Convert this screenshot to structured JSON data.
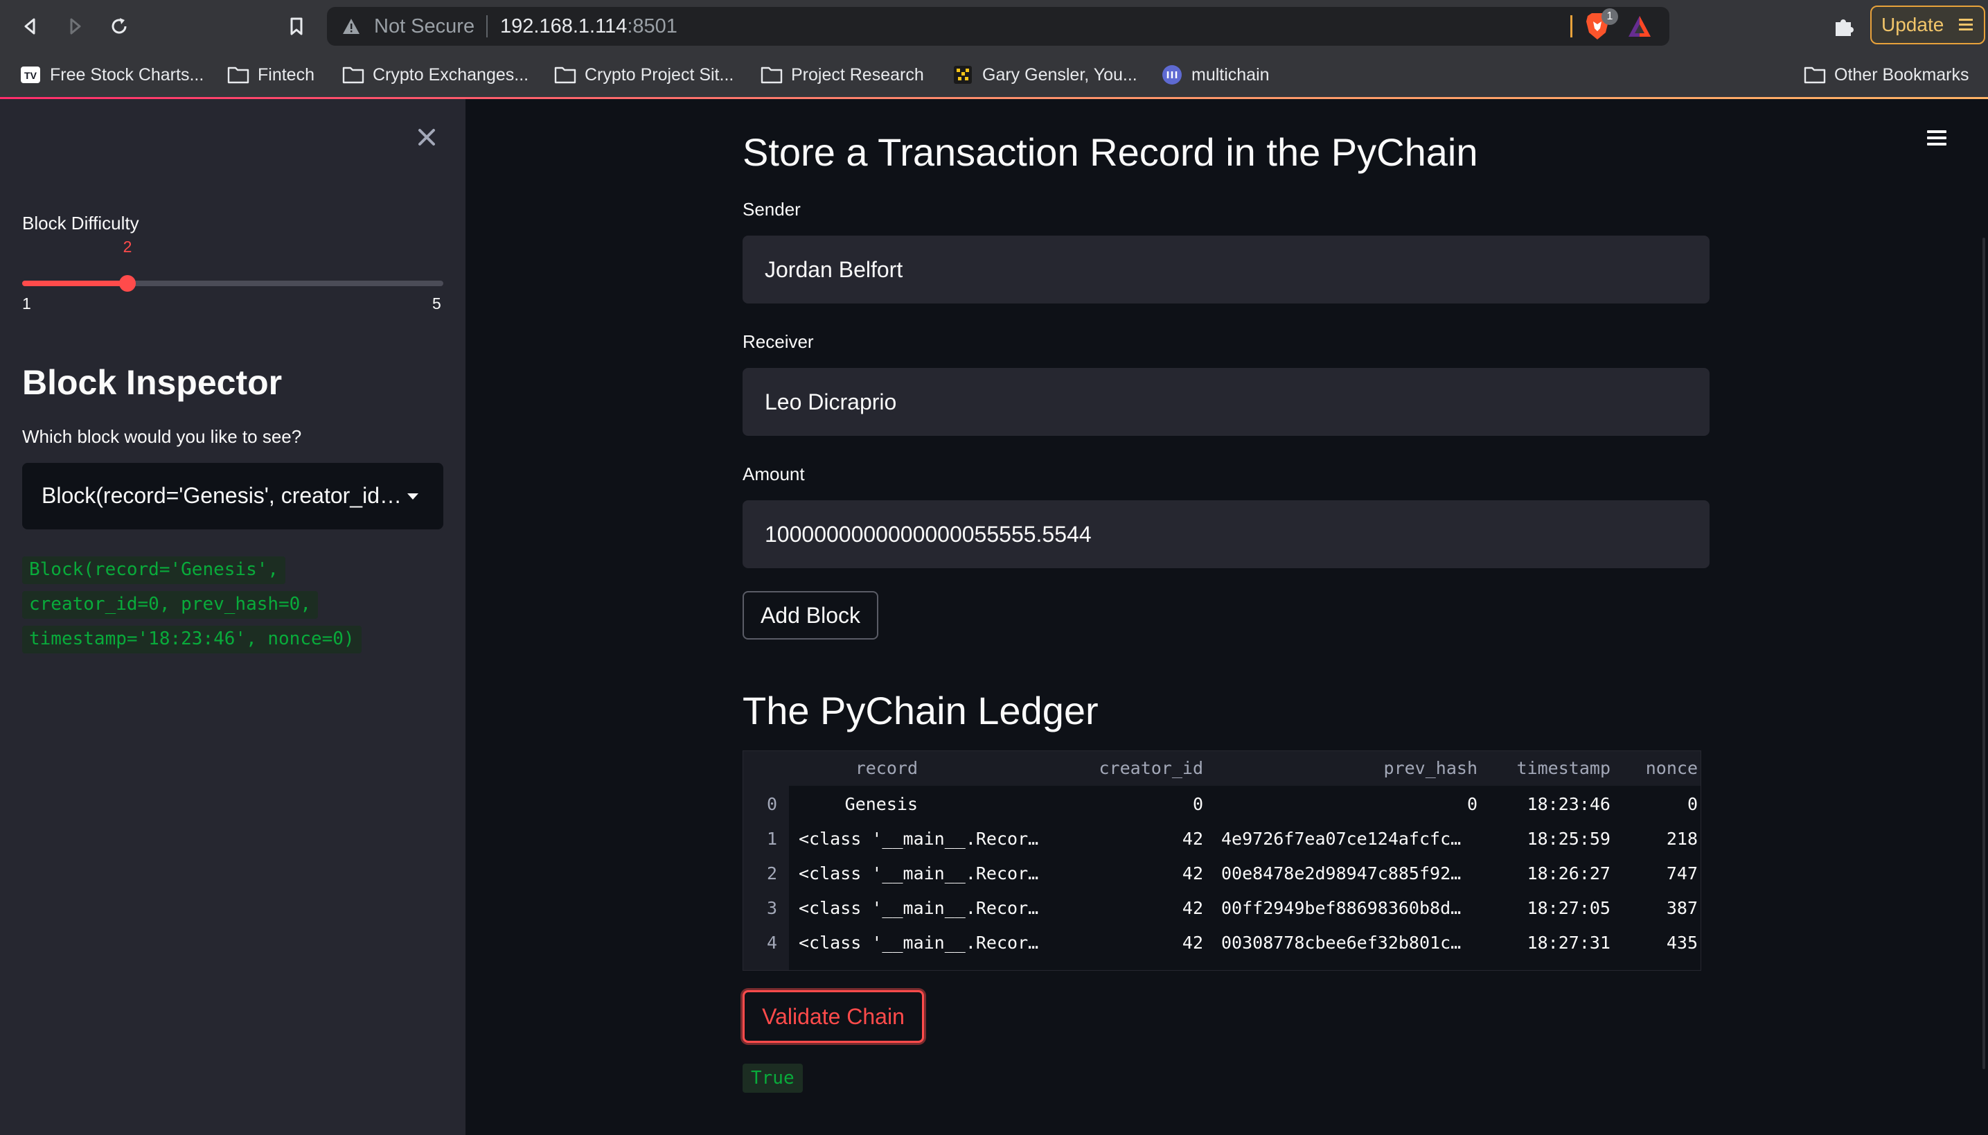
{
  "browser": {
    "security_label": "Not Secure",
    "url_host": "192.168.1.114",
    "url_port": ":8501",
    "brave_badge": "1",
    "update_label": "Update",
    "bookmarks": [
      {
        "label": "Free Stock Charts...",
        "icon": "tradingview-icon"
      },
      {
        "label": "Fintech",
        "icon": "folder-icon"
      },
      {
        "label": "Crypto Exchanges...",
        "icon": "folder-icon"
      },
      {
        "label": "Crypto Project Sit...",
        "icon": "folder-icon"
      },
      {
        "label": "Project Research",
        "icon": "folder-icon"
      },
      {
        "label": "Gary Gensler, You...",
        "icon": "site-icon"
      },
      {
        "label": "multichain",
        "icon": "multichain-icon"
      },
      {
        "label": "Other Bookmarks",
        "icon": "folder-icon"
      }
    ]
  },
  "sidebar": {
    "difficulty": {
      "label": "Block Difficulty",
      "value": 2,
      "value_label": "2",
      "min": 1,
      "max": 5,
      "min_label": "1",
      "max_label": "5"
    },
    "inspector_title": "Block Inspector",
    "inspector_question": "Which block would you like to see?",
    "selected_block": "Block(record='Genesis', creator_id=0, prev_hash=0, timestamp='18:23:46', nonce=0)",
    "block_code_lines": [
      "Block(record='Genesis',",
      "creator_id=0, prev_hash=0,",
      "timestamp='18:23:46', nonce=0)"
    ]
  },
  "main": {
    "title": "Store a Transaction Record in the PyChain",
    "sender_label": "Sender",
    "sender_value": "Jordan Belfort",
    "receiver_label": "Receiver",
    "receiver_value": "Leo Dicraprio",
    "amount_label": "Amount",
    "amount_value": "1000000000000000055555.5544",
    "add_block_label": "Add Block",
    "ledger_title": "The PyChain Ledger",
    "ledger": {
      "columns": [
        "record",
        "creator_id",
        "prev_hash",
        "timestamp",
        "nonce"
      ],
      "rows": [
        {
          "index": "0",
          "record": "Genesis",
          "creator_id": "0",
          "prev_hash": "0",
          "timestamp": "18:23:46",
          "nonce": "0"
        },
        {
          "index": "1",
          "record": "<class '__main__.Recor…",
          "creator_id": "42",
          "prev_hash": "4e9726f7ea07ce124afcfc…",
          "timestamp": "18:25:59",
          "nonce": "218"
        },
        {
          "index": "2",
          "record": "<class '__main__.Recor…",
          "creator_id": "42",
          "prev_hash": "00e8478e2d98947c885f92…",
          "timestamp": "18:26:27",
          "nonce": "747"
        },
        {
          "index": "3",
          "record": "<class '__main__.Recor…",
          "creator_id": "42",
          "prev_hash": "00ff2949bef88698360b8d…",
          "timestamp": "18:27:05",
          "nonce": "387"
        },
        {
          "index": "4",
          "record": "<class '__main__.Recor…",
          "creator_id": "42",
          "prev_hash": "00308778cbee6ef32b801c…",
          "timestamp": "18:27:31",
          "nonce": "435"
        }
      ]
    },
    "validate_label": "Validate Chain",
    "validate_result": "True"
  },
  "colors": {
    "accent": "#ff4b4b",
    "success": "#09ab3b",
    "background": "#0e1117",
    "sidebar": "#262730"
  }
}
